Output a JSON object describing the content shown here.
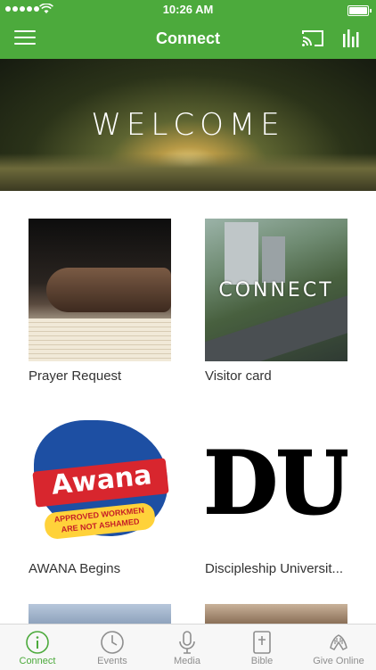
{
  "status_bar": {
    "time": "10:26 AM"
  },
  "nav": {
    "title": "Connect"
  },
  "hero": {
    "text": "WELCOME"
  },
  "tiles": [
    {
      "label": "Prayer Request"
    },
    {
      "label": "Visitor card",
      "overlay": "CONNECT"
    },
    {
      "label": "AWANA Begins",
      "logo_word": "Awana",
      "banner_line1": "APPROVED WORKMEN",
      "banner_line2": "ARE NOT ASHAMED"
    },
    {
      "label": "Discipleship Universit...",
      "logo_text": "DU"
    }
  ],
  "tabs": [
    {
      "label": "Connect"
    },
    {
      "label": "Events"
    },
    {
      "label": "Media"
    },
    {
      "label": "Bible"
    },
    {
      "label": "Give Online"
    }
  ],
  "colors": {
    "brand": "#4caa3c",
    "tab_inactive": "#8e8e8e"
  },
  "battery_level": 0.95
}
